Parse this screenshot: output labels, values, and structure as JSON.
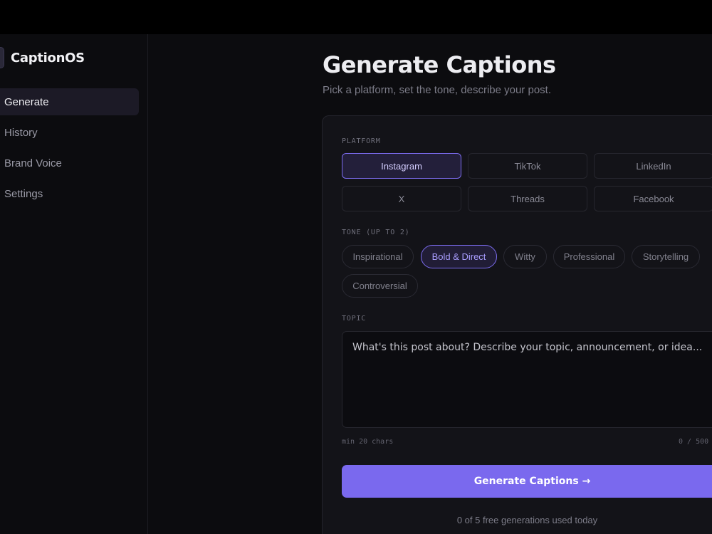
{
  "app": {
    "name": "CaptionOS"
  },
  "sidebar": {
    "items": [
      {
        "label": "Generate",
        "active": true
      },
      {
        "label": "History",
        "active": false
      },
      {
        "label": "Brand Voice",
        "active": false
      },
      {
        "label": "Settings",
        "active": false
      }
    ]
  },
  "page": {
    "title": "Generate Captions",
    "subtitle": "Pick a platform, set the tone, describe your post."
  },
  "form": {
    "platform_label": "PLATFORM",
    "platforms": [
      {
        "label": "Instagram",
        "selected": true
      },
      {
        "label": "TikTok",
        "selected": false
      },
      {
        "label": "LinkedIn",
        "selected": false
      },
      {
        "label": "X",
        "selected": false
      },
      {
        "label": "Threads",
        "selected": false
      },
      {
        "label": "Facebook",
        "selected": false
      }
    ],
    "tone_label": "TONE (UP TO 2)",
    "tones": [
      {
        "label": "Inspirational",
        "selected": false
      },
      {
        "label": "Bold & Direct",
        "selected": true
      },
      {
        "label": "Witty",
        "selected": false
      },
      {
        "label": "Professional",
        "selected": false
      },
      {
        "label": "Storytelling",
        "selected": false
      },
      {
        "label": "Controversial",
        "selected": false
      }
    ],
    "topic_label": "TOPIC",
    "topic_placeholder": "What's this post about? Describe your topic, announcement, or idea...",
    "topic_value": "",
    "min_hint": "min 20 chars",
    "char_count": "0 / 500",
    "submit_label": "Generate Captions →",
    "usage_text": "0 of 5 free generations used today"
  },
  "colors": {
    "accent": "#7a69ee",
    "background": "#0c0c0f",
    "card": "#131318"
  }
}
